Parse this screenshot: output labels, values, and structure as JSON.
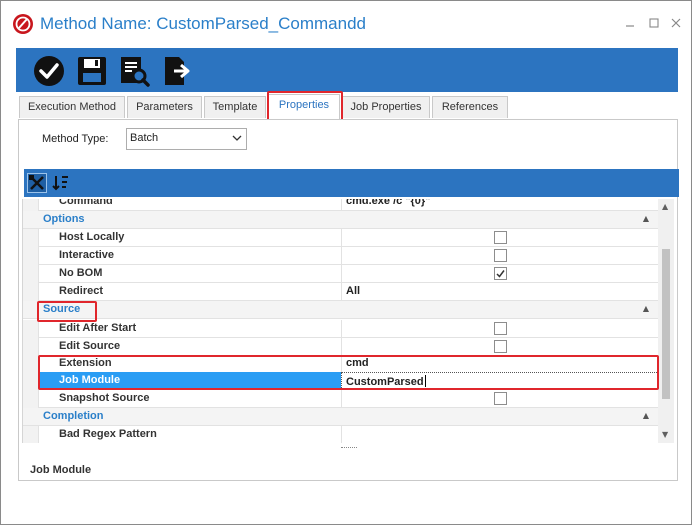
{
  "window": {
    "title": "Method Name: CustomParsed_Commandd",
    "accent": "#2c74c0",
    "controls": [
      "minimize-icon",
      "maximize-icon",
      "close-icon"
    ]
  },
  "toolbar": {
    "buttons": [
      "check-icon",
      "save-icon",
      "preview-icon",
      "export-icon"
    ]
  },
  "tabs": [
    {
      "label": "Execution Method"
    },
    {
      "label": "Parameters"
    },
    {
      "label": "Template"
    },
    {
      "label": "Properties",
      "active": true
    },
    {
      "label": "Job Properties"
    },
    {
      "label": "References"
    }
  ],
  "method_type": {
    "label": "Method Type:",
    "value": "Batch"
  },
  "grid_toolbar": {
    "buttons": [
      "categorize-icon",
      "sort-icon"
    ]
  },
  "properties": {
    "command_name": "Command",
    "command_value": "cmd.exe /c \"{0}\"",
    "options_label": "Options",
    "host_locally": "Host Locally",
    "interactive": "Interactive",
    "no_bom": "No BOM",
    "redirect": "Redirect",
    "redirect_value": "All",
    "source_label": "Source",
    "edit_after_start": "Edit After Start",
    "edit_source": "Edit Source",
    "extension": "Extension",
    "extension_value": "cmd",
    "job_module": "Job Module",
    "job_module_value": "CustomParsed",
    "snapshot_source": "Snapshot Source",
    "completion_label": "Completion",
    "bad_regex": "Bad Regex Pattern"
  },
  "checkbox_state": {
    "host_locally": false,
    "interactive": false,
    "no_bom": true,
    "edit_after_start": false,
    "edit_source": false,
    "snapshot_source": false
  },
  "description": {
    "title": "Job Module"
  },
  "highlight_color": "#e0262c"
}
